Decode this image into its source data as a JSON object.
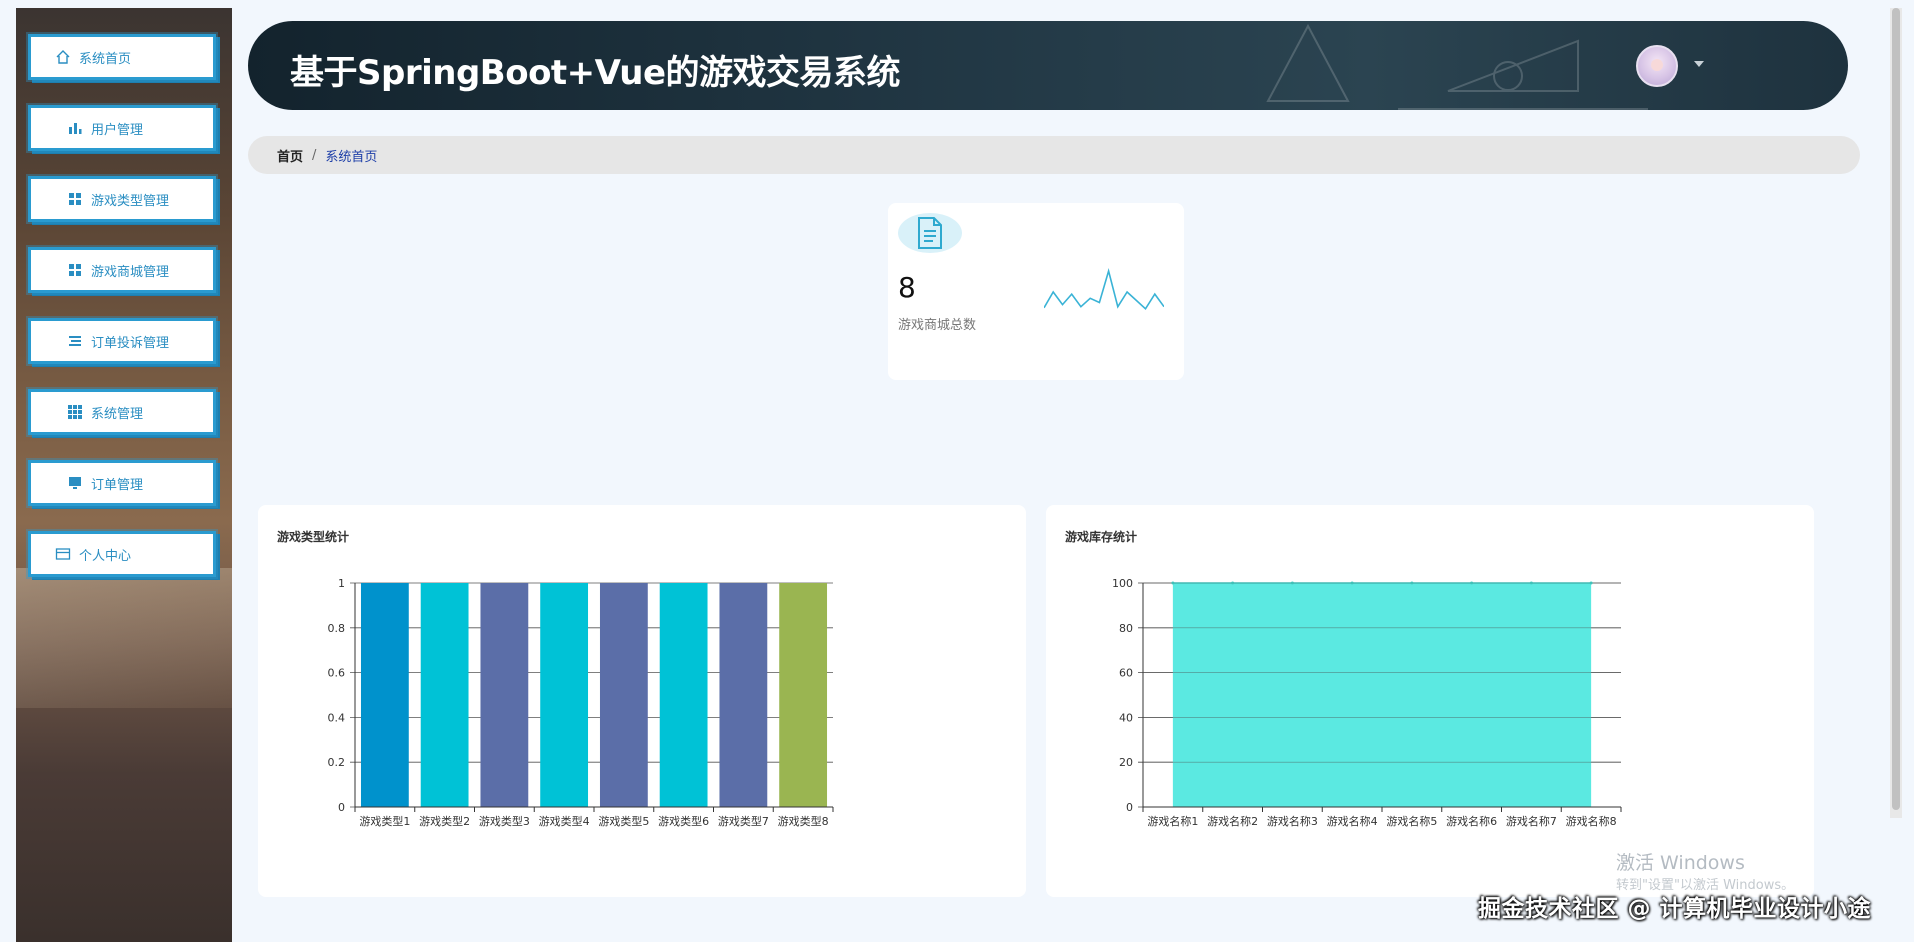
{
  "app": {
    "title": "基于SpringBoot+Vue的游戏交易系统"
  },
  "sidebar": {
    "items": [
      {
        "label": "系统首页",
        "icon": "home-icon"
      },
      {
        "label": "用户管理",
        "icon": "bar-chart-icon"
      },
      {
        "label": "游戏类型管理",
        "icon": "grid-icon"
      },
      {
        "label": "游戏商城管理",
        "icon": "grid-icon"
      },
      {
        "label": "订单投诉管理",
        "icon": "list-icon"
      },
      {
        "label": "系统管理",
        "icon": "apps-icon"
      },
      {
        "label": "订单管理",
        "icon": "monitor-icon"
      },
      {
        "label": "个人中心",
        "icon": "card-icon"
      }
    ]
  },
  "breadcrumb": {
    "home": "首页",
    "separator": "/",
    "current": "系统首页"
  },
  "stat": {
    "value": "8",
    "label": "游戏商城总数",
    "icon": "document-icon",
    "accent": "#3ab3d6",
    "sparkline": [
      5,
      20,
      8,
      18,
      6,
      14,
      10,
      40,
      6,
      20,
      12,
      4,
      18,
      6
    ]
  },
  "chart_data": [
    {
      "type": "bar",
      "title": "游戏类型统计",
      "categories": [
        "游戏类型1",
        "游戏类型2",
        "游戏类型3",
        "游戏类型4",
        "游戏类型5",
        "游戏类型6",
        "游戏类型7",
        "游戏类型8"
      ],
      "values": [
        1,
        1,
        1,
        1,
        1,
        1,
        1,
        1
      ],
      "colors": [
        "#0092cc",
        "#00c2d6",
        "#5b6ea8",
        "#00c2d6",
        "#5b6ea8",
        "#00c2d6",
        "#5b6ea8",
        "#9ab551"
      ],
      "yticks": [
        "0",
        "0.2",
        "0.4",
        "0.6",
        "0.8",
        "1"
      ],
      "ylim": [
        0,
        1
      ],
      "grid": true
    },
    {
      "type": "area",
      "title": "游戏库存统计",
      "categories": [
        "游戏名称1",
        "游戏名称2",
        "游戏名称3",
        "游戏名称4",
        "游戏名称5",
        "游戏名称6",
        "游戏名称7",
        "游戏名称8"
      ],
      "values": [
        100,
        100,
        100,
        100,
        100,
        100,
        100,
        100
      ],
      "color": "#52e8df",
      "yticks": [
        "0",
        "20",
        "40",
        "60",
        "80",
        "100"
      ],
      "ylim": [
        0,
        100
      ],
      "grid": true
    }
  ],
  "watermark": {
    "line1": "激活 Windows",
    "line2": "转到\"设置\"以激活 Windows。"
  },
  "credit": "掘金技术社区 @ 计算机毕业设计小途"
}
